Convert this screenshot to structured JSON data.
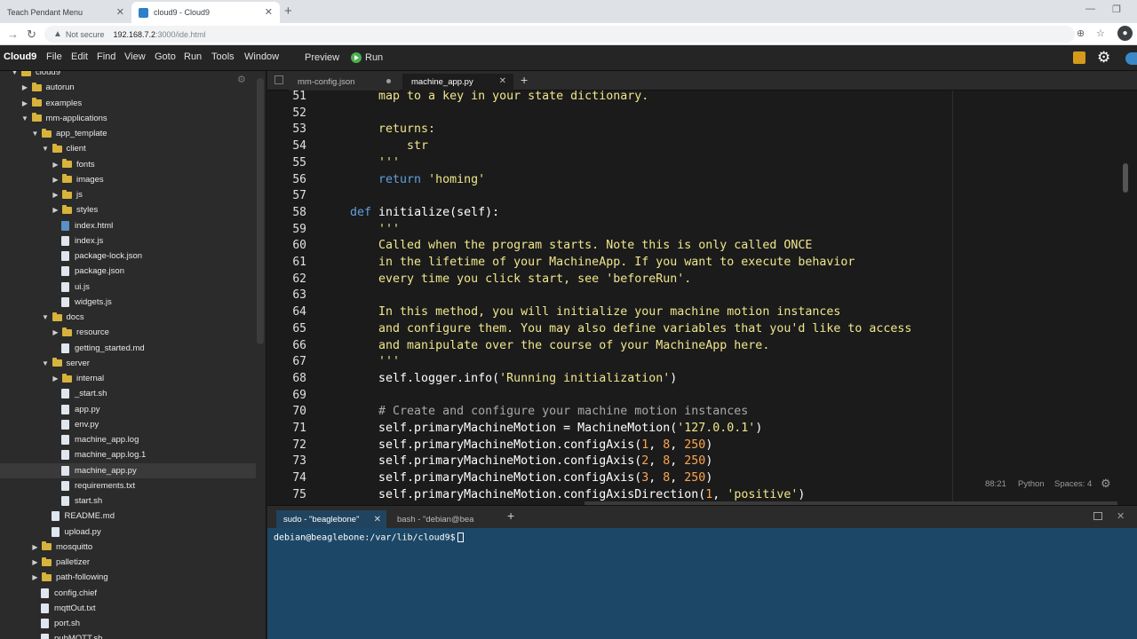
{
  "browser": {
    "tabs": [
      {
        "title": "Teach Pendant Menu",
        "active": false
      },
      {
        "title": "cloud9 - Cloud9",
        "active": true
      }
    ],
    "not_secure": "Not secure",
    "url_host": "192.168.7.2",
    "url_rest": ":3000/ide.html",
    "profile_initial": ""
  },
  "menubar": {
    "app_name": "Cloud9",
    "items": [
      "File",
      "Edit",
      "Find",
      "View",
      "Goto",
      "Run",
      "Tools",
      "Window"
    ],
    "preview": "Preview",
    "run": "Run"
  },
  "file_tree": [
    {
      "label": "cloud9",
      "type": "folder",
      "depth": 1,
      "open": true
    },
    {
      "label": "autorun",
      "type": "folder",
      "depth": 2,
      "open": false
    },
    {
      "label": "examples",
      "type": "folder",
      "depth": 2,
      "open": false
    },
    {
      "label": "mm-applications",
      "type": "folder",
      "depth": 2,
      "open": true
    },
    {
      "label": "app_template",
      "type": "folder",
      "depth": 3,
      "open": true
    },
    {
      "label": "client",
      "type": "folder",
      "depth": 4,
      "open": true
    },
    {
      "label": "fonts",
      "type": "folder",
      "depth": 5,
      "open": false
    },
    {
      "label": "images",
      "type": "folder",
      "depth": 5,
      "open": false
    },
    {
      "label": "js",
      "type": "folder",
      "depth": 5,
      "open": false
    },
    {
      "label": "styles",
      "type": "folder",
      "depth": 5,
      "open": false
    },
    {
      "label": "index.html",
      "type": "html",
      "depth": 5
    },
    {
      "label": "index.js",
      "type": "file",
      "depth": 5
    },
    {
      "label": "package-lock.json",
      "type": "file",
      "depth": 5
    },
    {
      "label": "package.json",
      "type": "file",
      "depth": 5
    },
    {
      "label": "ui.js",
      "type": "file",
      "depth": 5
    },
    {
      "label": "widgets.js",
      "type": "file",
      "depth": 5
    },
    {
      "label": "docs",
      "type": "folder",
      "depth": 4,
      "open": true
    },
    {
      "label": "resource",
      "type": "folder",
      "depth": 5,
      "open": false
    },
    {
      "label": "getting_started.md",
      "type": "file",
      "depth": 5
    },
    {
      "label": "server",
      "type": "folder",
      "depth": 4,
      "open": true
    },
    {
      "label": "internal",
      "type": "folder",
      "depth": 5,
      "open": false
    },
    {
      "label": "_start.sh",
      "type": "file",
      "depth": 5
    },
    {
      "label": "app.py",
      "type": "file",
      "depth": 5
    },
    {
      "label": "env.py",
      "type": "file",
      "depth": 5
    },
    {
      "label": "machine_app.log",
      "type": "file",
      "depth": 5
    },
    {
      "label": "machine_app.log.1",
      "type": "file",
      "depth": 5
    },
    {
      "label": "machine_app.py",
      "type": "file",
      "depth": 5,
      "selected": true
    },
    {
      "label": "requirements.txt",
      "type": "file",
      "depth": 5
    },
    {
      "label": "start.sh",
      "type": "file",
      "depth": 5
    },
    {
      "label": "README.md",
      "type": "file",
      "depth": 4
    },
    {
      "label": "upload.py",
      "type": "file",
      "depth": 4
    },
    {
      "label": "mosquitto",
      "type": "folder",
      "depth": 3,
      "open": false
    },
    {
      "label": "palletizer",
      "type": "folder",
      "depth": 3,
      "open": false
    },
    {
      "label": "path-following",
      "type": "folder",
      "depth": 3,
      "open": false
    },
    {
      "label": "config.chief",
      "type": "file",
      "depth": 3
    },
    {
      "label": "mqttOut.txt",
      "type": "file",
      "depth": 3
    },
    {
      "label": "port.sh",
      "type": "file",
      "depth": 3
    },
    {
      "label": "pubMQTT.sh",
      "type": "file",
      "depth": 3
    }
  ],
  "editor": {
    "tabs": [
      {
        "label": "mm-config.json",
        "active": false,
        "modified": true
      },
      {
        "label": "machine_app.py",
        "active": true,
        "modified": false
      }
    ],
    "lines": [
      {
        "n": "51",
        "t": "    map to a key in your state dictionary.",
        "k": "doc"
      },
      {
        "n": "52",
        "t": "",
        "k": "doc"
      },
      {
        "n": "53",
        "t": "    returns:",
        "k": "doc"
      },
      {
        "n": "54",
        "t": "        str",
        "k": "doc"
      },
      {
        "n": "55",
        "t": "    '''",
        "k": "doc"
      },
      {
        "n": "56",
        "t": "    return 'homing'",
        "k": "ret"
      },
      {
        "n": "57",
        "t": "",
        "k": "plain"
      },
      {
        "n": "58",
        "t": "def initialize(self):",
        "k": "def"
      },
      {
        "n": "59",
        "t": "    '''",
        "k": "doc"
      },
      {
        "n": "60",
        "t": "    Called when the program starts. Note this is only called ONCE",
        "k": "doc"
      },
      {
        "n": "61",
        "t": "    in the lifetime of your MachineApp. If you want to execute behavior",
        "k": "doc"
      },
      {
        "n": "62",
        "t": "    every time you click start, see 'beforeRun'.",
        "k": "doc"
      },
      {
        "n": "63",
        "t": "",
        "k": "doc"
      },
      {
        "n": "64",
        "t": "    In this method, you will initialize your machine motion instances",
        "k": "doc"
      },
      {
        "n": "65",
        "t": "    and configure them. You may also define variables that you'd like to access",
        "k": "doc"
      },
      {
        "n": "66",
        "t": "    and manipulate over the course of your MachineApp here.",
        "k": "doc"
      },
      {
        "n": "67",
        "t": "    '''",
        "k": "doc"
      },
      {
        "n": "68",
        "t": "    self.logger.info('Running initialization')",
        "k": "call"
      },
      {
        "n": "69",
        "t": "",
        "k": "plain"
      },
      {
        "n": "70",
        "t": "    # Create and configure your machine motion instances",
        "k": "cmt"
      },
      {
        "n": "71",
        "t": "    self.primaryMachineMotion = MachineMotion('127.0.0.1')",
        "k": "call"
      },
      {
        "n": "72",
        "t": "    self.primaryMachineMotion.configAxis(1, 8, 250)",
        "k": "nums"
      },
      {
        "n": "73",
        "t": "    self.primaryMachineMotion.configAxis(2, 8, 250)",
        "k": "nums"
      },
      {
        "n": "74",
        "t": "    self.primaryMachineMotion.configAxis(3, 8, 250)",
        "k": "nums"
      },
      {
        "n": "75",
        "t": "    self.primaryMachineMotion.configAxisDirection(1, 'positive')",
        "k": "nums"
      }
    ],
    "status": {
      "position": "88:21",
      "language": "Python",
      "indent": "Spaces: 4"
    }
  },
  "terminal": {
    "tabs": [
      {
        "label": "sudo - \"beaglebone\"",
        "active": true
      },
      {
        "label": "bash - \"debian@bea",
        "active": false
      }
    ],
    "prompt": "debian@beaglebone:/var/lib/cloud9$"
  },
  "colors": {
    "docstring": "#f0e68c",
    "keyword": "#5fa0e0",
    "number": "#ffa64d",
    "comment": "#a9a9a9",
    "terminal_bg": "#1d4766",
    "folder": "#d7b33c"
  }
}
